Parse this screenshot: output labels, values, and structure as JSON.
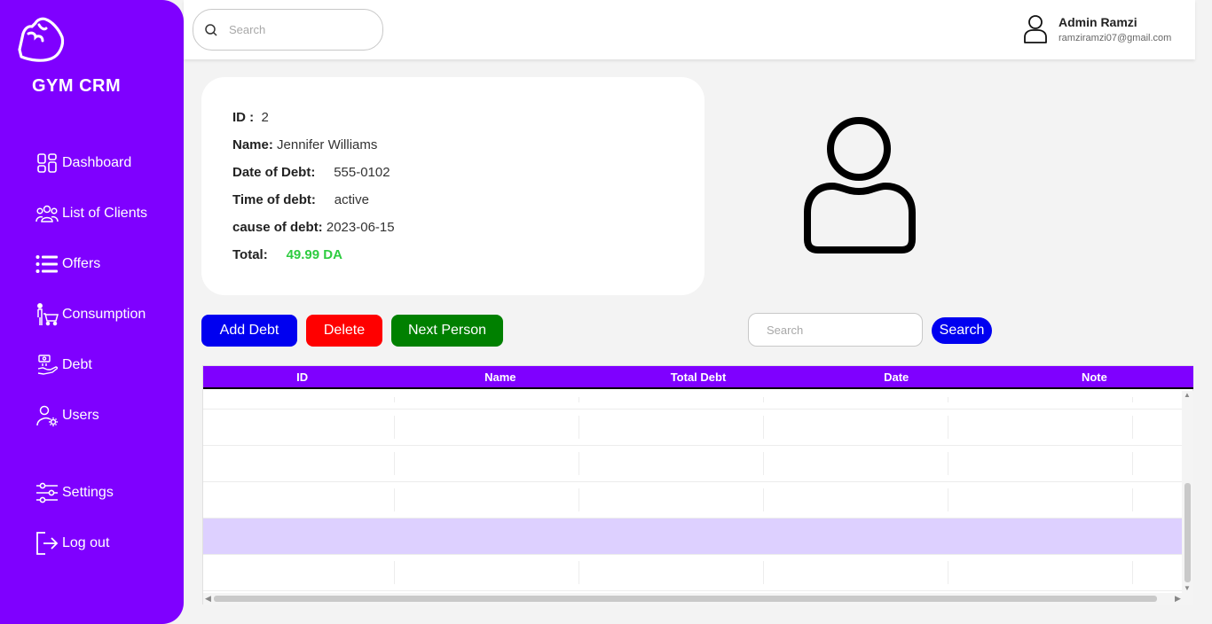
{
  "sidebar": {
    "brand": "GYM CRM",
    "items": [
      {
        "label": "Dashboard",
        "icon": "dashboard-grid-icon"
      },
      {
        "label": "List of Clients",
        "icon": "clients-group-icon"
      },
      {
        "label": "Offers",
        "icon": "list-icon"
      },
      {
        "label": "Consumption",
        "icon": "cart-person-icon"
      },
      {
        "label": "Debt",
        "icon": "debt-hand-icon"
      },
      {
        "label": "Users",
        "icon": "user-gear-icon"
      },
      {
        "label": "Settings",
        "icon": "sliders-icon"
      },
      {
        "label": "Log out",
        "icon": "logout-icon"
      }
    ]
  },
  "topbar": {
    "search_placeholder": "Search",
    "user_name": "Admin Ramzi",
    "user_email": "ramziramzi07@gmail.com"
  },
  "debt_card": {
    "id_label": "ID :",
    "id_value": "2",
    "name_label": "Name:",
    "name_value": "Jennifer Williams",
    "date_label": "Date of Debt:",
    "date_value": "555-0102",
    "time_label": "Time of debt:",
    "time_value": "active",
    "cause_label": "cause of debt:",
    "cause_value": "2023-06-15",
    "total_label": "Total:",
    "total_value": "49.99 DA"
  },
  "actions": {
    "add_label": "Add Debt",
    "delete_label": "Delete",
    "next_label": "Next Person",
    "search_placeholder": "Search",
    "search_label": "Search"
  },
  "table": {
    "columns": [
      "ID",
      "Name",
      "Total Debt",
      "Date",
      "Note"
    ],
    "rows": [
      [],
      [],
      [],
      [],
      [],
      []
    ],
    "selected_row": 4
  },
  "colors": {
    "accent": "#7f00ff",
    "add_button": "#0000f0",
    "delete_button": "#ff0000",
    "next_button": "#008000",
    "total_value": "#2ecc40",
    "selected_row": "#ddd0ff"
  }
}
